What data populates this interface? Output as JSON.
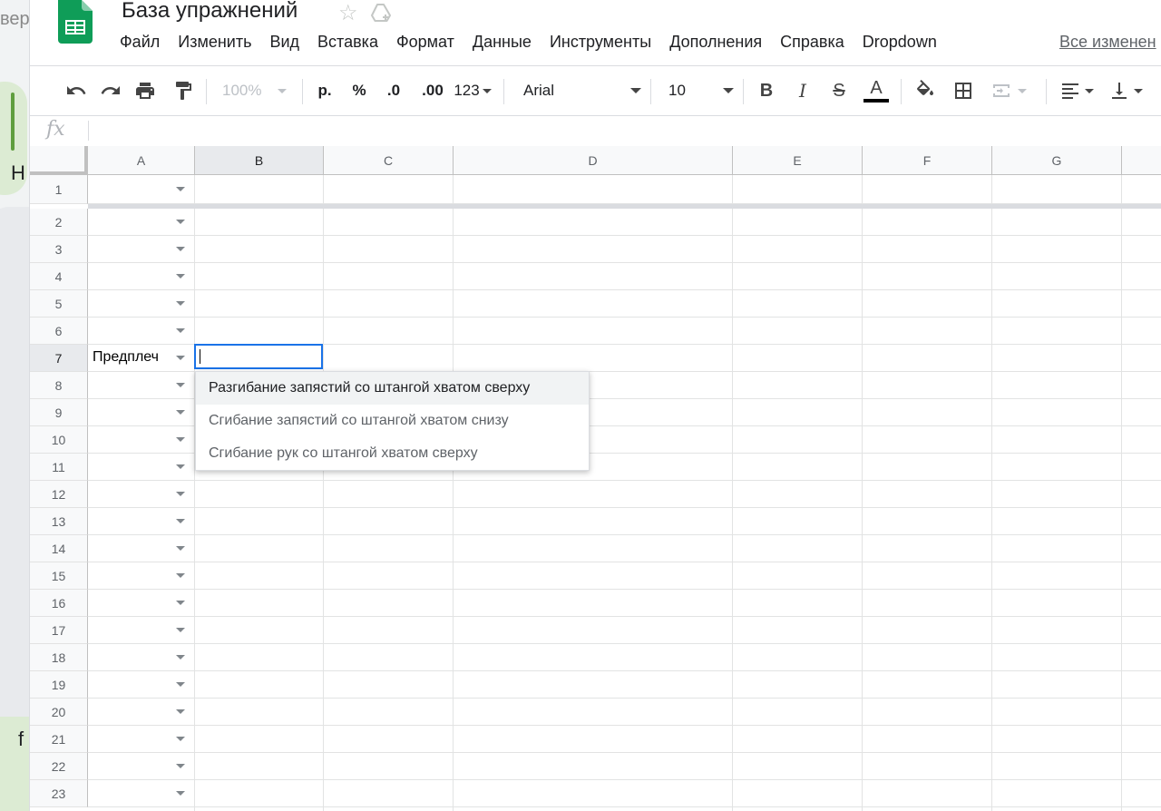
{
  "background": {
    "left_text_top": "вер",
    "left_text_mid": "Н",
    "left_text_bottom": "f"
  },
  "header": {
    "title": "База упражнений",
    "all_changes": "Все изменен"
  },
  "menu": [
    "Файл",
    "Изменить",
    "Вид",
    "Вставка",
    "Формат",
    "Данные",
    "Инструменты",
    "Дополнения",
    "Справка",
    "Dropdown"
  ],
  "toolbar": {
    "zoom": "100%",
    "currency": "р.",
    "percent": "%",
    "decrease_decimals": ".0",
    "increase_decimals": ".00",
    "more_formats": "123",
    "font": "Arial",
    "font_size": "10",
    "bold": "B",
    "italic": "I",
    "strike": "S",
    "text_color_label": "A"
  },
  "formula_bar": {
    "fx_label": "fx"
  },
  "columns": [
    "A",
    "B",
    "C",
    "D",
    "E",
    "F",
    "G"
  ],
  "rows": [
    "1",
    "2",
    "3",
    "4",
    "5",
    "6",
    "7",
    "8",
    "9",
    "10",
    "11",
    "12",
    "13",
    "14",
    "15",
    "16",
    "17",
    "18",
    "19",
    "20",
    "21",
    "22",
    "23"
  ],
  "selected_column": "B",
  "selected_row": "7",
  "cells": {
    "a7": "Предплеч"
  },
  "dropdown": {
    "options": [
      "Разгибание запястий со штангой хватом сверху",
      "Сгибание запястий со штангой хватом снизу",
      "Сгибание рук со штангой хватом сверху"
    ]
  },
  "colors": {
    "accent": "#1a73e8",
    "sheets_green": "#0f9d58"
  }
}
